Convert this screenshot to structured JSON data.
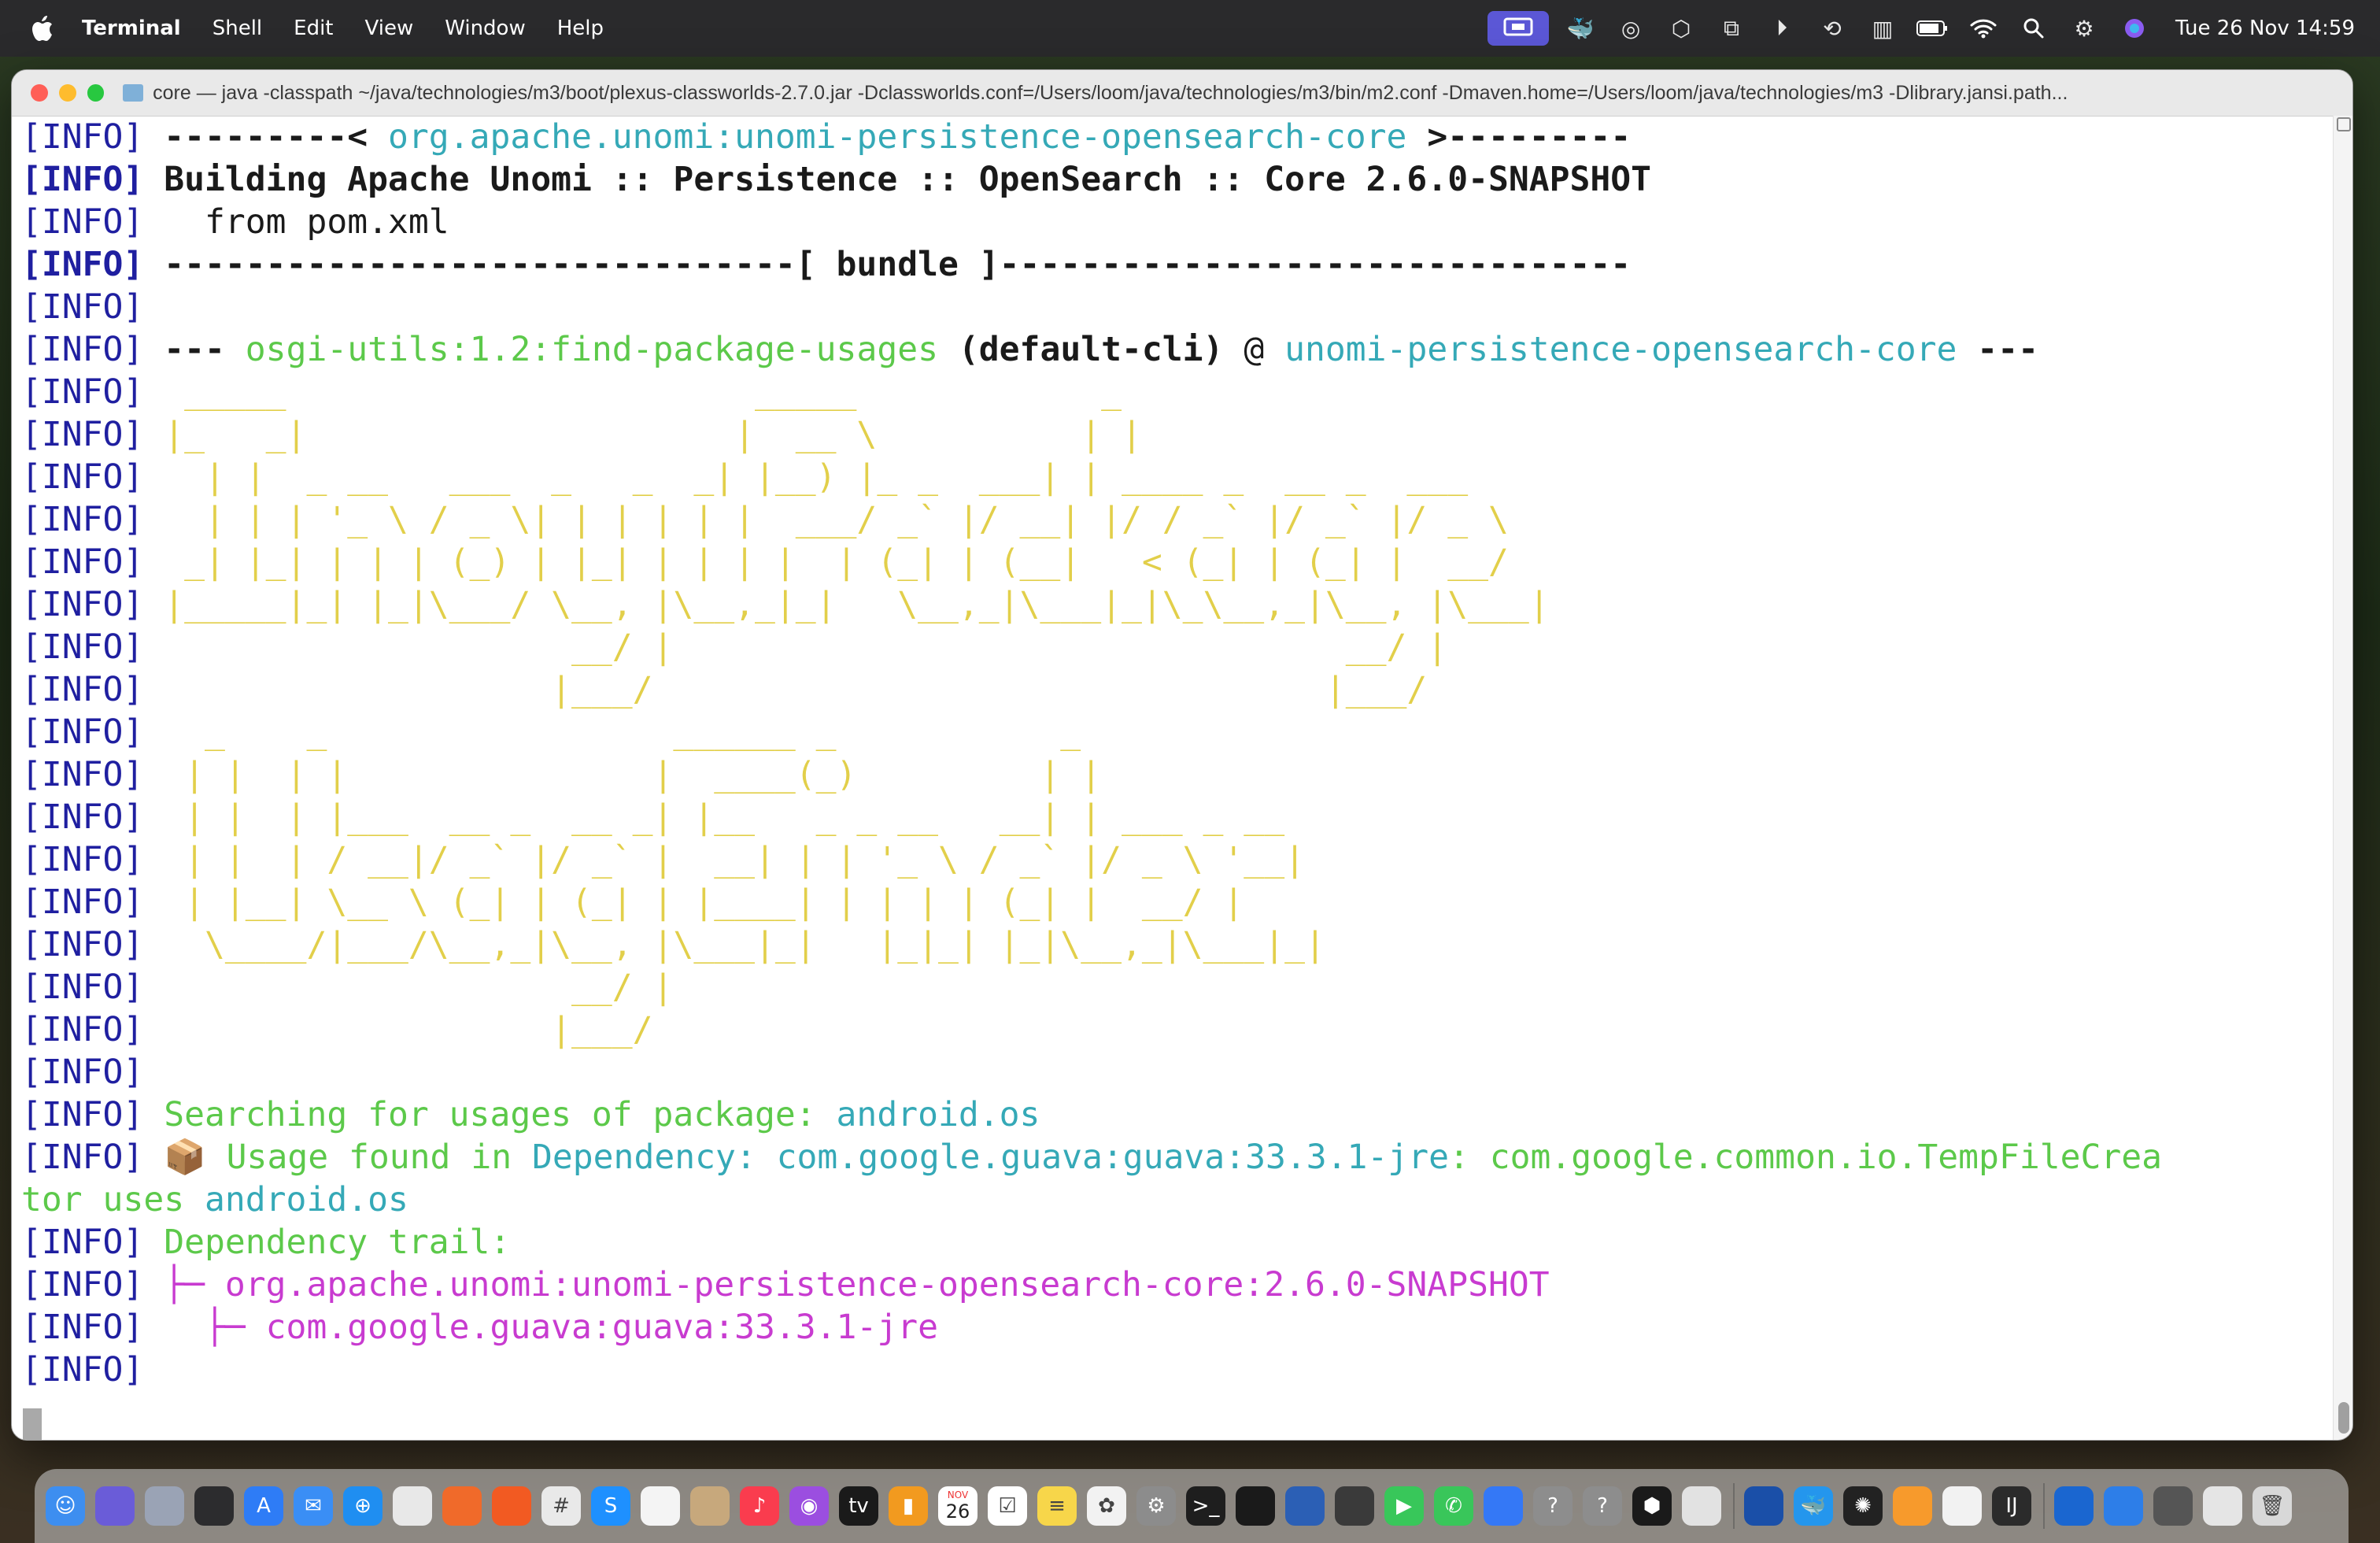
{
  "menubar": {
    "app_name": "Terminal",
    "items": [
      "Shell",
      "Edit",
      "View",
      "Window",
      "Help"
    ],
    "status_icons": [
      "screen-mirroring-icon",
      "docker-icon",
      "airplay-audio-icon",
      "package-icon",
      "vpn-icon",
      "play-icon",
      "time-machine-icon",
      "memory-icon",
      "battery-icon",
      "wifi-icon",
      "search-icon",
      "control-center-icon",
      "siri-icon"
    ],
    "clock": "Tue 26 Nov  14:59"
  },
  "window": {
    "title": "core — java -classpath ~/java/technologies/m3/boot/plexus-classworlds-2.7.0.jar -Dclassworlds.conf=/Users/loom/java/technologies/m3/bin/m2.conf -Dmaven.home=/Users/loom/java/technologies/m3 -Dlibrary.jansi.path..."
  },
  "terminal": {
    "prefix": "[INFO]",
    "lines": {
      "l1_a": " ---------< ",
      "l1_b": "org.apache.unomi:unomi-persistence-opensearch-core",
      "l1_c": " >---------",
      "l2": " Building Apache Unomi :: Persistence :: OpenSearch :: Core 2.6.0-SNAPSHOT",
      "l3": "   from pom.xml",
      "l4": " -------------------------------[ bundle ]-------------------------------",
      "l6_a": " --- ",
      "l6_b": "osgi-utils:1.2:find-package-usages",
      "l6_c": " (default-cli)",
      "l6_d": " @ ",
      "l6_e": "unomi-persistence-opensearch-core",
      "l6_f": " ---",
      "search_a": " Searching for usages of package: ",
      "search_b": "android.os",
      "usage_a": " 📦 ",
      "usage_b": "Usage found in ",
      "usage_c": "Dependency: com.google.guava:guava:33.3.1-jre",
      "usage_d": ": com.google.common.io.TempFileCrea",
      "usage_wrap_a": "tor uses ",
      "usage_wrap_b": "android.os",
      "trail": " Dependency trail:",
      "trail_1": " ├─ org.apache.unomi:unomi-persistence-opensearch-core:2.6.0-SNAPSHOT",
      "trail_2": "   ├─ com.google.guava:guava:33.3.1-jre"
    },
    "ascii_art": [
      "  _____                       _____            _",
      " |_   _|                     |  __ \\          | |",
      "   | |  _ __   ___  _   _  _| |__) |_ _  ___| | ____ _  __ _  ___",
      "   | | | '_ \\ / _ \\| | | | | |  ___/ _` |/ __| |/ / _` |/ _` |/ _ \\",
      "  _| |_| | | | (_) | |_| | | | |  | (_| | (__|   < (_| | (_| |  __/",
      " |_____|_| |_|\\___/ \\__, |\\__,_|_|   \\__,_|\\___|_|\\_\\__,_|\\__, |\\___|",
      "                     __/ |                                 __/ |",
      "                    |___/                                 |___/",
      "   _    _                 ______ _           _",
      "  | |  | |               |  ____(_)         | |",
      "  | |  | |___  __ _  __ _| |__   _ _ __   __| | ___ _ __",
      "  | |  | / __|/ _` |/ _` |  __| | | '_ \\ / _` |/ _ \\ '__|",
      "  | |__| \\__ \\ (_| | (_| | |____| | | | | (_| |  __/ |",
      "   \\____/|___/\\__,_|\\__, |\\___|_|   |_|_| |_|\\__,_|\\___|_|",
      "                     __/ |",
      "                    |___/"
    ]
  },
  "dock": {
    "apps": [
      "finder-icon",
      "siri-icon",
      "launchpad-icon",
      "mission-control-icon",
      "app-store-icon",
      "mail-icon",
      "safari-icon",
      "chrome-icon",
      "firefox-icon",
      "brave-icon",
      "slack-icon",
      "skype-icon",
      "textedit-icon",
      "contacts-icon",
      "music-icon",
      "podcasts-icon",
      "tv-icon",
      "books-icon",
      "calendar-icon",
      "reminders-icon",
      "notes-icon",
      "photos-icon",
      "system-settings-icon",
      "terminal-icon",
      "activity-monitor-icon",
      "sourcetree-icon",
      "console-icon",
      "facetime-icon",
      "messages-icon",
      "xcode-icon",
      "unknown-app-icon",
      "unknown-app-icon-2",
      "github-icon",
      "preview-icon",
      "teamviewer-icon",
      "docker-icon",
      "chatgpt-icon",
      "sublime-icon",
      "textedit-2-icon",
      "intellij-icon",
      "onepassword-icon",
      "network-icon",
      "file-icon",
      "documents-icon",
      "trash-icon"
    ],
    "calendar_day": "26",
    "calendar_month": "NOV"
  },
  "colors": {
    "info_prefix": "#1f1fa0",
    "cyan": "#35a9b7",
    "green": "#5cc94a",
    "ascii_yellow": "#e2cf4a",
    "magenta": "#c83bd0"
  }
}
